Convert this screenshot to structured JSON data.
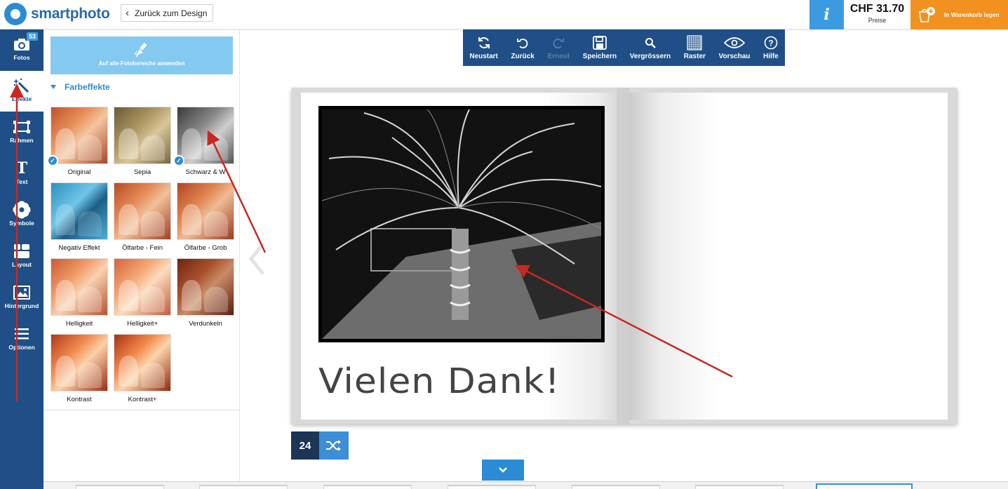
{
  "header": {
    "brand": "smartphoto",
    "back_label": "Zurück zum Design",
    "price": "CHF 31.70",
    "price_label": "Preise",
    "info_icon": "i",
    "cart_label": "In Warenkorb legen"
  },
  "colors": {
    "nav_bg": "#1f4f86",
    "accent_blue": "#2b8bd4",
    "cart_orange": "#f39120",
    "info_blue": "#3c9be0",
    "annotation_red": "#c8281e"
  },
  "sidebar": {
    "items": [
      {
        "label": "Fotos",
        "icon": "camera-icon",
        "badge": "53"
      },
      {
        "label": "Effekte",
        "icon": "magic-wand-icon"
      },
      {
        "label": "Rahmen",
        "icon": "frame-icon"
      },
      {
        "label": "Text",
        "icon": "text-icon"
      },
      {
        "label": "Symbole",
        "icon": "flower-icon"
      },
      {
        "label": "Layout",
        "icon": "layout-icon"
      },
      {
        "label": "Hintergrund",
        "icon": "background-image-icon"
      },
      {
        "label": "Optionen",
        "icon": "menu-icon"
      }
    ]
  },
  "panel": {
    "apply_all_label": "Auf alle Fotobereiche anwenden",
    "section_title": "Farbeffekte",
    "effects": [
      {
        "label": "Original",
        "checked": true
      },
      {
        "label": "Sepia",
        "checked": false
      },
      {
        "label": "Schwarz & W",
        "checked": true
      },
      {
        "label": "Negativ Effekt",
        "checked": false
      },
      {
        "label": "Ölfarbe - Fein",
        "checked": false
      },
      {
        "label": "Ölfarbe - Grob",
        "checked": false
      },
      {
        "label": "Helligkeit",
        "checked": false
      },
      {
        "label": "Helligkeit+",
        "checked": false
      },
      {
        "label": "Verdunkeln",
        "checked": false
      },
      {
        "label": "Kontrast",
        "checked": false
      },
      {
        "label": "Kontrast+",
        "checked": false
      }
    ]
  },
  "toolbar": {
    "items": [
      {
        "label": "Neustart",
        "icon": "refresh-icon",
        "disabled": false
      },
      {
        "label": "Zurück",
        "icon": "undo-icon",
        "disabled": false
      },
      {
        "label": "Erneut",
        "icon": "redo-icon",
        "disabled": true
      },
      {
        "label": "Speichern",
        "icon": "save-icon",
        "disabled": false
      },
      {
        "label": "Vergrössern",
        "icon": "zoom-icon",
        "disabled": false
      },
      {
        "label": "Raster",
        "icon": "grid-icon",
        "disabled": false
      },
      {
        "label": "Vorschau",
        "icon": "eye-icon",
        "disabled": false
      },
      {
        "label": "Hilfe",
        "icon": "help-icon",
        "disabled": false
      }
    ]
  },
  "book": {
    "page_text": "Vielen Dank!",
    "page_number": "24"
  }
}
